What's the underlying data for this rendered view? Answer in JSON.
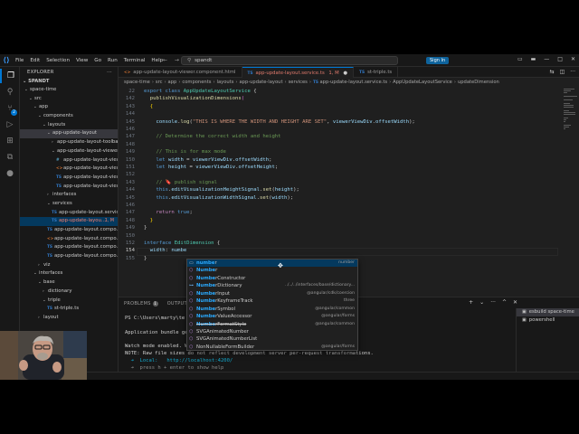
{
  "titlebar": {
    "logo": "vscode-logo",
    "menu": [
      "File",
      "Edit",
      "Selection",
      "View",
      "Go",
      "Run",
      "Terminal",
      "Help"
    ],
    "search_text": "spandt",
    "signin_label": "Sign In"
  },
  "sidebar": {
    "header": "EXPLORER",
    "project": "SPANDT",
    "tree": [
      {
        "label": "space-time",
        "kind": "folder",
        "open": true,
        "indent": 1
      },
      {
        "label": "src",
        "kind": "folder",
        "open": true,
        "indent": 2
      },
      {
        "label": "app",
        "kind": "folder",
        "open": true,
        "indent": 3
      },
      {
        "label": "components",
        "kind": "folder",
        "open": true,
        "indent": 4
      },
      {
        "label": "layouts",
        "kind": "folder",
        "open": true,
        "indent": 5
      },
      {
        "label": "app-update-layout",
        "kind": "folder",
        "open": true,
        "indent": 6,
        "selected": true
      },
      {
        "label": "app-update-layout-toolbar",
        "kind": "folder",
        "open": false,
        "indent": 7
      },
      {
        "label": "app-update-layout-viewer",
        "kind": "folder",
        "open": true,
        "indent": 7
      },
      {
        "label": "app-update-layout-viewe...",
        "kind": "css",
        "indent": 8
      },
      {
        "label": "app-update-layout-viewe...",
        "kind": "html",
        "indent": 8
      },
      {
        "label": "app-update-layout-viewe...",
        "kind": "ts",
        "indent": 8
      },
      {
        "label": "app-update-layout-viewe...",
        "kind": "ts",
        "indent": 8
      },
      {
        "label": "interfaces",
        "kind": "folder",
        "open": false,
        "indent": 6
      },
      {
        "label": "services",
        "kind": "folder",
        "open": true,
        "indent": 6
      },
      {
        "label": "app-update-layout.servic...",
        "kind": "ts",
        "indent": 7
      },
      {
        "label": "app-update-layou...",
        "kind": "ts",
        "indent": 7,
        "active": true,
        "flag": "1, M"
      },
      {
        "label": "app-update-layout.compo...",
        "kind": "ts",
        "indent": 6
      },
      {
        "label": "app-update-layout.compo...",
        "kind": "html",
        "indent": 6
      },
      {
        "label": "app-update-layout.compo...",
        "kind": "ts",
        "indent": 6
      },
      {
        "label": "app-update-layout.compo...",
        "kind": "ts",
        "indent": 6
      },
      {
        "label": "viz",
        "kind": "folder",
        "open": false,
        "indent": 4
      },
      {
        "label": "interfaces",
        "kind": "folder",
        "open": true,
        "indent": 3
      },
      {
        "label": "base",
        "kind": "folder",
        "open": true,
        "indent": 4
      },
      {
        "label": "dictionary",
        "kind": "folder",
        "open": false,
        "indent": 5
      },
      {
        "label": "triple",
        "kind": "folder",
        "open": true,
        "indent": 5
      },
      {
        "label": "st-triple.ts",
        "kind": "ts",
        "indent": 6
      },
      {
        "label": "layout",
        "kind": "folder",
        "open": false,
        "indent": 4
      }
    ]
  },
  "tabs": [
    {
      "label": "app-update-layout-viewer.component.html",
      "kind": "html",
      "active": false
    },
    {
      "label": "app-update-layout.service.ts",
      "kind": "ts",
      "active": true,
      "suffix": "1, M"
    },
    {
      "label": "st-triple.ts",
      "kind": "ts",
      "active": false
    }
  ],
  "breadcrumb": [
    "space-time",
    "src",
    "app",
    "components",
    "layouts",
    "app-update-layout",
    "services",
    "app-update-layout.service.ts",
    "AppUpdateLayoutService",
    "updateDimension"
  ],
  "code": {
    "lines": [
      {
        "n": "22",
        "tokens": [
          [
            "kw",
            "export "
          ],
          [
            "kw",
            "class "
          ],
          [
            "cls",
            "AppUpdateLayoutService "
          ],
          [
            "pun",
            "{"
          ]
        ]
      },
      {
        "n": "142",
        "tokens": [
          [
            "pun",
            "  "
          ],
          [
            "fn",
            "publishVisualizationDimensions"
          ],
          [
            "brk",
            "("
          ]
        ]
      },
      {
        "n": "143",
        "tokens": [
          [
            "pun",
            "  "
          ],
          [
            "brk2",
            "{"
          ]
        ]
      },
      {
        "n": "144",
        "tokens": []
      },
      {
        "n": "145",
        "tokens": [
          [
            "pun",
            "    "
          ],
          [
            "var",
            "console"
          ],
          [
            "pun",
            "."
          ],
          [
            "fn",
            "log"
          ],
          [
            "pun",
            "("
          ],
          [
            "str",
            "\"THIS IS WHERE THE WIDTH AND HEIGHT ARE SET\""
          ],
          [
            "pun",
            ", "
          ],
          [
            "var",
            "viewerViewDiv"
          ],
          [
            "pun",
            "."
          ],
          [
            "var",
            "offsetWidth"
          ],
          [
            "pun",
            ");"
          ]
        ]
      },
      {
        "n": "146",
        "tokens": []
      },
      {
        "n": "147",
        "tokens": [
          [
            "cmt",
            "    // Determine the correct width and height"
          ]
        ]
      },
      {
        "n": "148",
        "tokens": []
      },
      {
        "n": "149",
        "tokens": [
          [
            "cmt",
            "    // This is for max mode"
          ]
        ]
      },
      {
        "n": "150",
        "tokens": [
          [
            "pun",
            "    "
          ],
          [
            "kw",
            "let "
          ],
          [
            "var",
            "width"
          ],
          [
            "pun",
            " = "
          ],
          [
            "var",
            "viewerViewDiv"
          ],
          [
            "pun",
            "."
          ],
          [
            "var",
            "offsetWidth"
          ],
          [
            "pun",
            ";"
          ]
        ]
      },
      {
        "n": "151",
        "tokens": [
          [
            "pun",
            "    "
          ],
          [
            "kw",
            "let "
          ],
          [
            "var",
            "height"
          ],
          [
            "pun",
            " = "
          ],
          [
            "var",
            "viewerViewDiv"
          ],
          [
            "pun",
            "."
          ],
          [
            "var",
            "offsetHeight"
          ],
          [
            "pun",
            ";"
          ]
        ]
      },
      {
        "n": "152",
        "tokens": []
      },
      {
        "n": "143",
        "tokens": [
          [
            "cmt",
            "    // 🔖 publish signal"
          ]
        ]
      },
      {
        "n": "144",
        "tokens": [
          [
            "pun",
            "    "
          ],
          [
            "kw",
            "this"
          ],
          [
            "pun",
            "."
          ],
          [
            "var",
            "editVisualizationHeightSignal"
          ],
          [
            "pun",
            "."
          ],
          [
            "fn",
            "set"
          ],
          [
            "pun",
            "("
          ],
          [
            "var",
            "height"
          ],
          [
            "pun",
            ");"
          ]
        ]
      },
      {
        "n": "145",
        "tokens": [
          [
            "pun",
            "    "
          ],
          [
            "kw",
            "this"
          ],
          [
            "pun",
            "."
          ],
          [
            "var",
            "editVisualizationWidthSignal"
          ],
          [
            "pun",
            "."
          ],
          [
            "fn",
            "set"
          ],
          [
            "pun",
            "("
          ],
          [
            "var",
            "width"
          ],
          [
            "pun",
            ");"
          ]
        ]
      },
      {
        "n": "146",
        "tokens": []
      },
      {
        "n": "147",
        "tokens": [
          [
            "pun",
            "    "
          ],
          [
            "ctl",
            "return "
          ],
          [
            "kw",
            "true"
          ],
          [
            "pun",
            ";"
          ]
        ]
      },
      {
        "n": "148",
        "tokens": [
          [
            "pun",
            "  "
          ],
          [
            "brk2",
            "}"
          ]
        ]
      },
      {
        "n": "149",
        "tokens": [
          [
            "pun",
            "}"
          ]
        ]
      },
      {
        "n": "150",
        "tokens": []
      },
      {
        "n": "152",
        "tokens": [
          [
            "kw",
            "interface "
          ],
          [
            "cls",
            "EditDimension "
          ],
          [
            "pun",
            "{"
          ]
        ]
      },
      {
        "n": "154",
        "tokens": [
          [
            "pun",
            "  "
          ],
          [
            "var",
            "width"
          ],
          [
            "pun",
            ": "
          ],
          [
            "var",
            "numbe"
          ]
        ],
        "current": true
      },
      {
        "n": "155",
        "tokens": [
          [
            "pun",
            "}"
          ]
        ]
      }
    ]
  },
  "suggest": {
    "items": [
      {
        "icon": "kw",
        "label": "number",
        "match": "numbe",
        "detail": "number",
        "selected": true
      },
      {
        "icon": "var",
        "label": "Number",
        "match": "Numbe",
        "detail": ""
      },
      {
        "icon": "var",
        "label": "NumberConstructor",
        "match": "Numbe",
        "detail": ""
      },
      {
        "icon": "iface",
        "label": "NumberDictionary",
        "match": "Numbe",
        "detail": "../../../interfaces/base/dictionary..."
      },
      {
        "icon": "var",
        "label": "NumberInput",
        "match": "Numbe",
        "detail": "@angular/cdk/coercion"
      },
      {
        "icon": "var",
        "label": "NumberKeyframeTrack",
        "match": "Numbe",
        "detail": "three"
      },
      {
        "icon": "var",
        "label": "NumberSymbol",
        "match": "Numbe",
        "detail": "@angular/common"
      },
      {
        "icon": "var",
        "label": "NumberValueAccessor",
        "match": "Numbe",
        "detail": "@angular/forms"
      },
      {
        "icon": "var",
        "label": "NumberFormatStyle",
        "match": "Numbe",
        "detail": "@angular/common",
        "strike": true
      },
      {
        "icon": "var",
        "label": "SVGAnimatedNumber",
        "match": "Numbe",
        "detail": ""
      },
      {
        "icon": "var",
        "label": "SVGAnimatedNumberList",
        "match": "Numbe",
        "detail": ""
      },
      {
        "icon": "var",
        "label": "NonNullableFormBuilder",
        "match": "",
        "detail": "@angular/forms"
      }
    ]
  },
  "panel": {
    "tabs": [
      "PROBLEMS",
      "OUTPUT"
    ],
    "problems_count": "1",
    "terminal_lines": [
      {
        "text": "PS C:\\Users\\marty\\te",
        "cls": ""
      },
      {
        "text": "",
        "cls": ""
      },
      {
        "text": "Application bundle ge                                                  5.527]",
        "cls": ""
      },
      {
        "text": "",
        "cls": ""
      },
      {
        "text": "Watch mode enabled. W",
        "cls": ""
      },
      {
        "text": "NOTE: Raw file sizes do not reflect development server per-request transformations.",
        "cls": ""
      },
      {
        "text": "  ➜  Local:   http://localhost:4200/",
        "cls": "cyan"
      },
      {
        "text": "  ➜  press h + enter to show help",
        "cls": "grey"
      }
    ],
    "terminals": [
      {
        "label": "esbuild  space-time",
        "selected": true
      },
      {
        "label": "powershell",
        "selected": false
      }
    ]
  }
}
